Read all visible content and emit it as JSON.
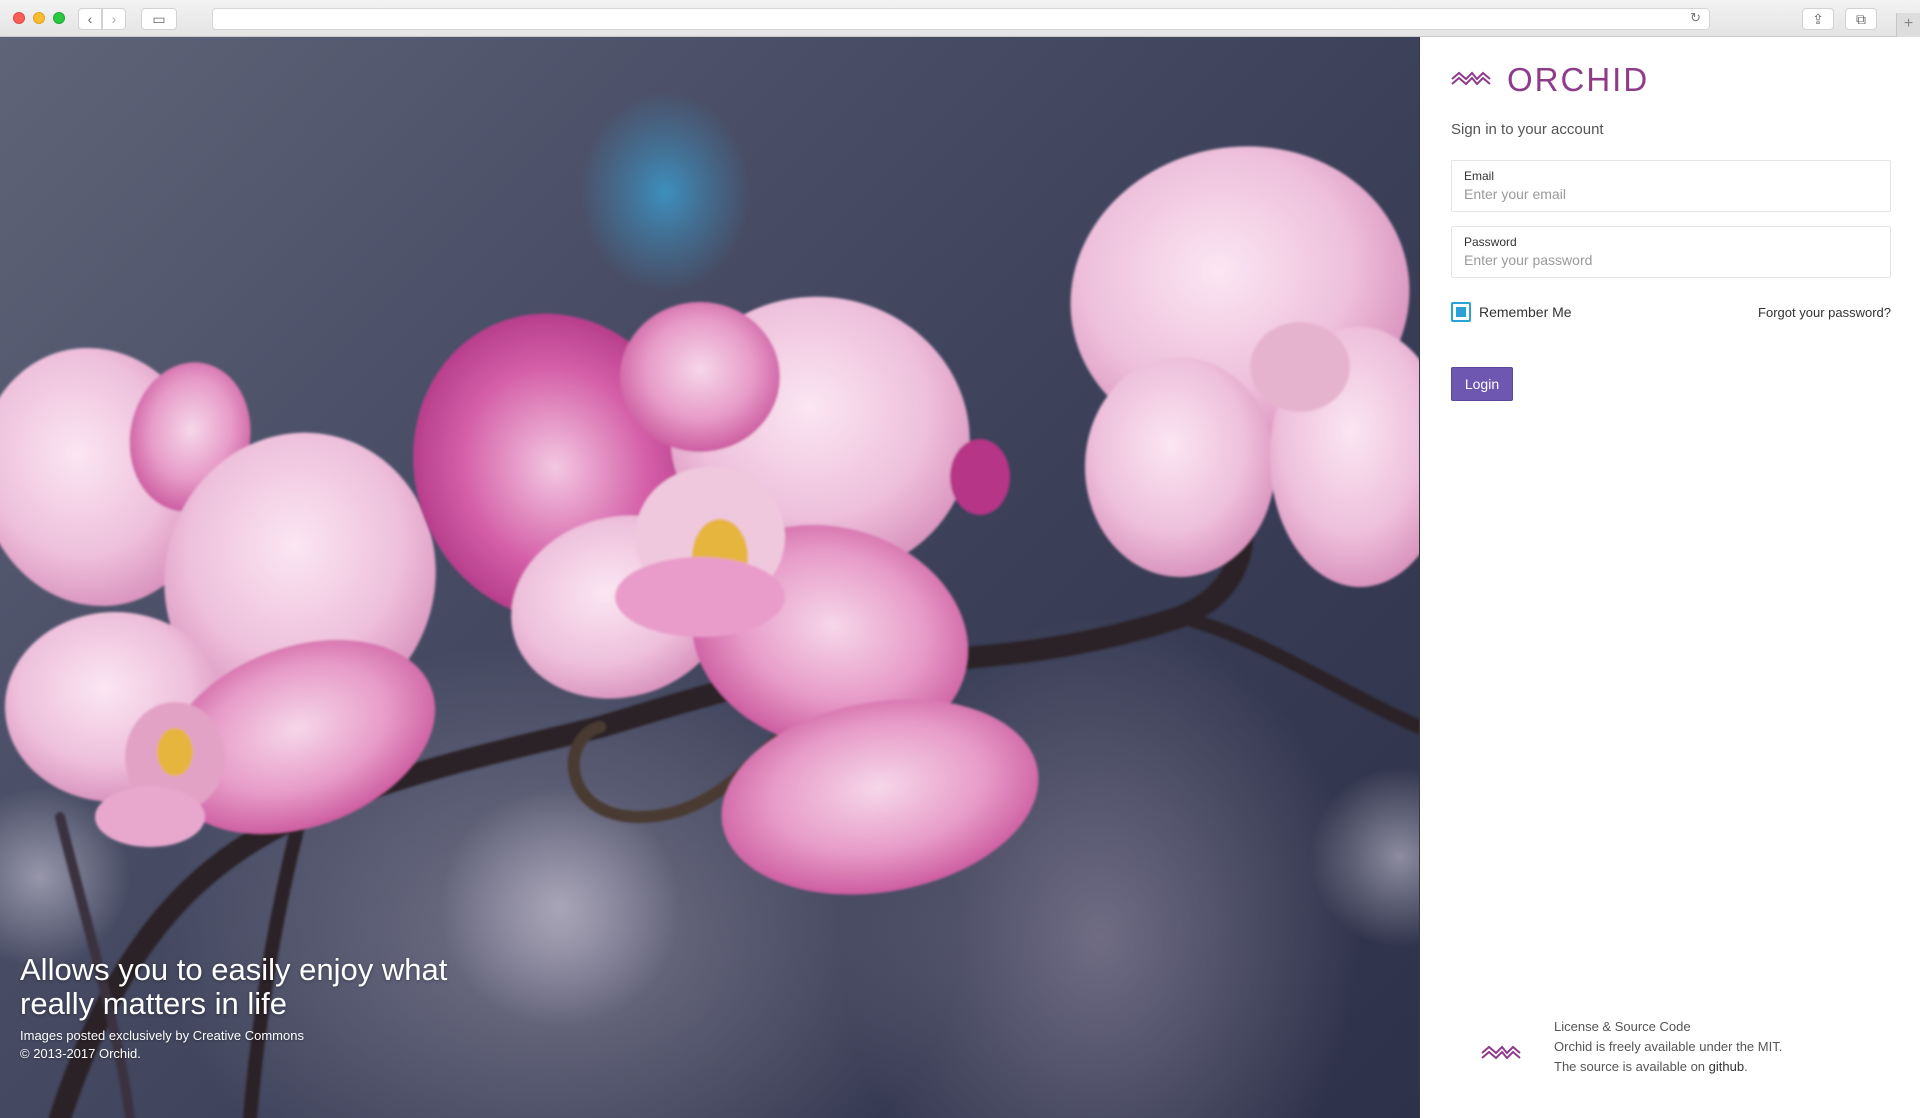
{
  "browser": {
    "back_icon": "‹",
    "forward_icon": "›",
    "sidebar_icon": "▭",
    "reload_icon": "↻",
    "share_icon": "⇪",
    "tabs_icon": "⧉",
    "newtab_icon": "+",
    "address_value": ""
  },
  "hero": {
    "heading": "Allows you to easily enjoy what really matters in life",
    "credit": "Images posted exclusively by Creative Commons",
    "copyright": "© 2013-2017 Orchid."
  },
  "brand": {
    "name": "ORCHID",
    "color": "#8e3b89"
  },
  "login": {
    "subtitle": "Sign in to your account",
    "email_label": "Email",
    "email_placeholder": "Enter your email",
    "password_label": "Password",
    "password_placeholder": "Enter your password",
    "remember_label": "Remember Me",
    "remember_checked": true,
    "forgot_label": "Forgot your password?",
    "submit_label": "Login",
    "submit_color": "#6d57b0"
  },
  "footer": {
    "license_title": "License & Source Code",
    "license_text": "Orchid is freely available under the MIT.",
    "source_prefix": "The source is available on ",
    "source_link": "github",
    "source_suffix": "."
  }
}
